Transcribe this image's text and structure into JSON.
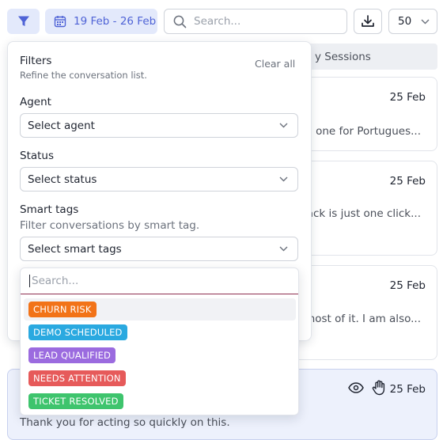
{
  "toolbar": {
    "date_range": "19 Feb - 26 Feb",
    "search_placeholder": "Search...",
    "page_size": "50"
  },
  "background": {
    "tab_label": "y Sessions",
    "cards": [
      {
        "date": "25 Feb",
        "snippet": "d one for Portugues..."
      },
      {
        "date": "25 Feb",
        "snippet": "back is just one click..."
      },
      {
        "date": "25 Feb",
        "snippet": "most of it. I am also..."
      }
    ],
    "highlighted_card": {
      "date": "25 Feb",
      "snippet": "Thank you for acting so quickly on this."
    }
  },
  "filters": {
    "title": "Filters",
    "subtitle": "Refine the conversation list.",
    "clear_all": "Clear all",
    "agent": {
      "label": "Agent",
      "value": "Select agent"
    },
    "status": {
      "label": "Status",
      "value": "Select status"
    },
    "smart_tags": {
      "label": "Smart tags",
      "description": "Filter conversations by smart tag.",
      "value": "Select smart tags"
    }
  },
  "dropdown": {
    "search_placeholder": "Search...",
    "options": [
      {
        "label": "CHURN RISK",
        "color": "#f27318"
      },
      {
        "label": "DEMO SCHEDULED",
        "color": "#2aa9e0"
      },
      {
        "label": "LEAD QUALIFIED",
        "color": "#9b6bdf"
      },
      {
        "label": "NEEDS ATTENTION",
        "color": "#e65a5a"
      },
      {
        "label": "TICKET RESOLVED",
        "color": "#3ec46d"
      }
    ]
  },
  "colors": {
    "accent": "#4f63d6",
    "accent_bg": "#e3e9fb",
    "highlight_card_bg": "#edf1fc"
  }
}
